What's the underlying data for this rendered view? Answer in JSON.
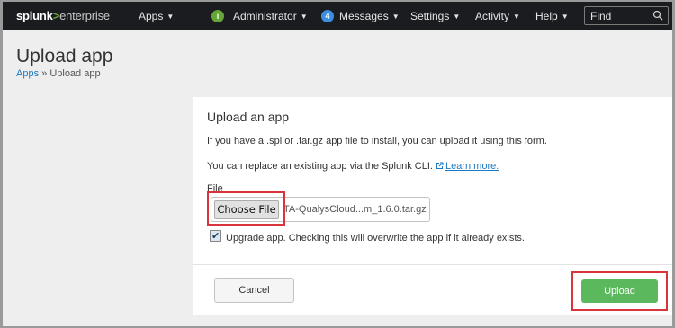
{
  "nav": {
    "logo_main": "splunk",
    "logo_sep": ">",
    "logo_sub": "enterprise",
    "apps": "Apps",
    "admin_badge": "i",
    "administrator": "Administrator",
    "messages_count": "4",
    "messages": "Messages",
    "settings": "Settings",
    "activity": "Activity",
    "help": "Help",
    "find_value": "Find"
  },
  "page": {
    "title": "Upload app",
    "breadcrumb_apps": "Apps",
    "breadcrumb_sep": " » ",
    "breadcrumb_current": "Upload app"
  },
  "form": {
    "title": "Upload an app",
    "intro": "If you have a .spl or .tar.gz app file to install, you can upload it using this form.",
    "cli_text": "You can replace an existing app via the Splunk CLI. ",
    "learn_more": "Learn more.",
    "file_label": "File",
    "choose_file": "Choose File",
    "file_name": "TA-QualysCloud...m_1.6.0.tar.gz",
    "upgrade_checked": true,
    "upgrade_label": "Upgrade app. Checking this will overwrite the app if it already exists.",
    "cancel": "Cancel",
    "upload": "Upload"
  },
  "colors": {
    "accent_green": "#65a637",
    "upload_green": "#5cb85c",
    "link_blue": "#1e7ac2",
    "highlight_red": "#d9333c",
    "nav_bg": "#1a1c20"
  },
  "icons": [
    "info-icon",
    "search-icon",
    "external-link-icon",
    "checkmark-icon",
    "caret-down-icon"
  ]
}
